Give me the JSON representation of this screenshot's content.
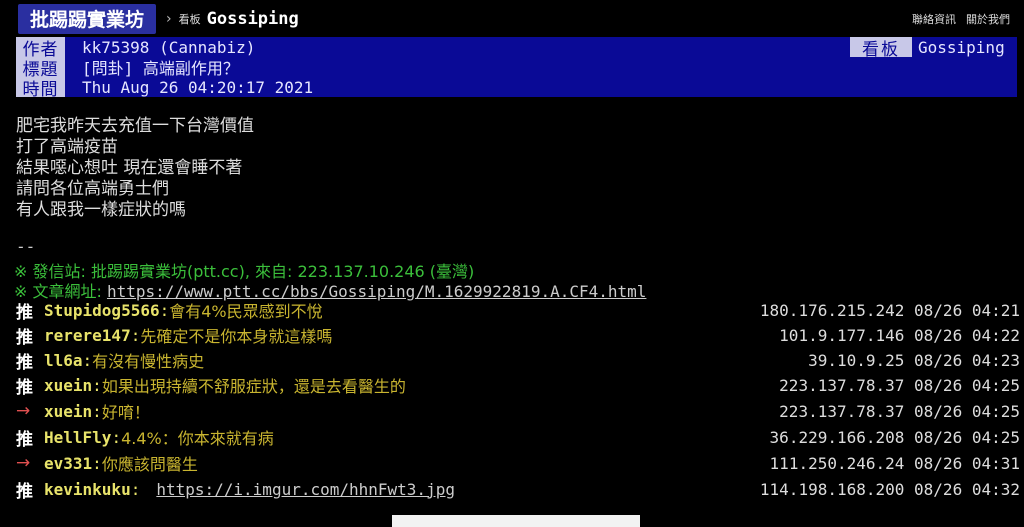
{
  "nav": {
    "site": "批踢踢實業坊",
    "separator": "›",
    "board_tag": "看板",
    "board": "Gossiping",
    "links": [
      "聯絡資訊",
      "關於我們"
    ]
  },
  "header": {
    "author_label": "作者",
    "author": "kk75398 (Cannabiz)",
    "board_label": "看板",
    "board": "Gossiping",
    "title_label": "標題",
    "title": "[問卦] 高端副作用？",
    "time_label": "時間",
    "time": "Thu Aug 26 04:20:17 2021"
  },
  "body": [
    "肥宅我昨天去充值一下台灣價值",
    "打了高端疫苗",
    "結果噁心想吐  現在還會睡不著",
    "請問各位高端勇士們",
    "有人跟我一樣症狀的嗎"
  ],
  "signature": {
    "sep": "--",
    "line1": "※ 發信站: 批踢踢實業坊(ptt.cc), 來自: 223.137.10.246 (臺灣)",
    "url_label": "※ 文章網址: ",
    "url": "https://www.ptt.cc/bbs/Gossiping/M.1629922819.A.CF4.html"
  },
  "pushes": [
    {
      "tag": "推",
      "user": "Stupidog5566",
      "content": "會有4%民眾感到不悅",
      "ipdt": "180.176.215.242 08/26 04:21"
    },
    {
      "tag": "推",
      "user": "rerere147",
      "content": "先確定不是你本身就這樣嗎",
      "ipdt": "101.9.177.146 08/26 04:22"
    },
    {
      "tag": "推",
      "user": "ll6a",
      "content": "有沒有慢性病史",
      "ipdt": "39.10.9.25 08/26 04:23"
    },
    {
      "tag": "推",
      "user": "xuein",
      "content": "如果出現持續不舒服症狀，還是去看醫生的",
      "ipdt": "223.137.78.37 08/26 04:25"
    },
    {
      "tag": "→",
      "user": "xuein",
      "content": "好唷！",
      "ipdt": "223.137.78.37 08/26 04:25"
    },
    {
      "tag": "推",
      "user": "HellFly",
      "content": "4.4%：你本來就有病",
      "ipdt": "36.229.166.208 08/26 04:25"
    },
    {
      "tag": "→",
      "user": "ev331",
      "content": "你應該問醫生",
      "ipdt": "111.250.246.24 08/26 04:31"
    },
    {
      "tag": "推",
      "user": "kevinkuku",
      "content": "https://i.imgur.com/hhnFwt3.jpg",
      "ipdt": "114.198.168.200 08/26 04:32"
    }
  ]
}
